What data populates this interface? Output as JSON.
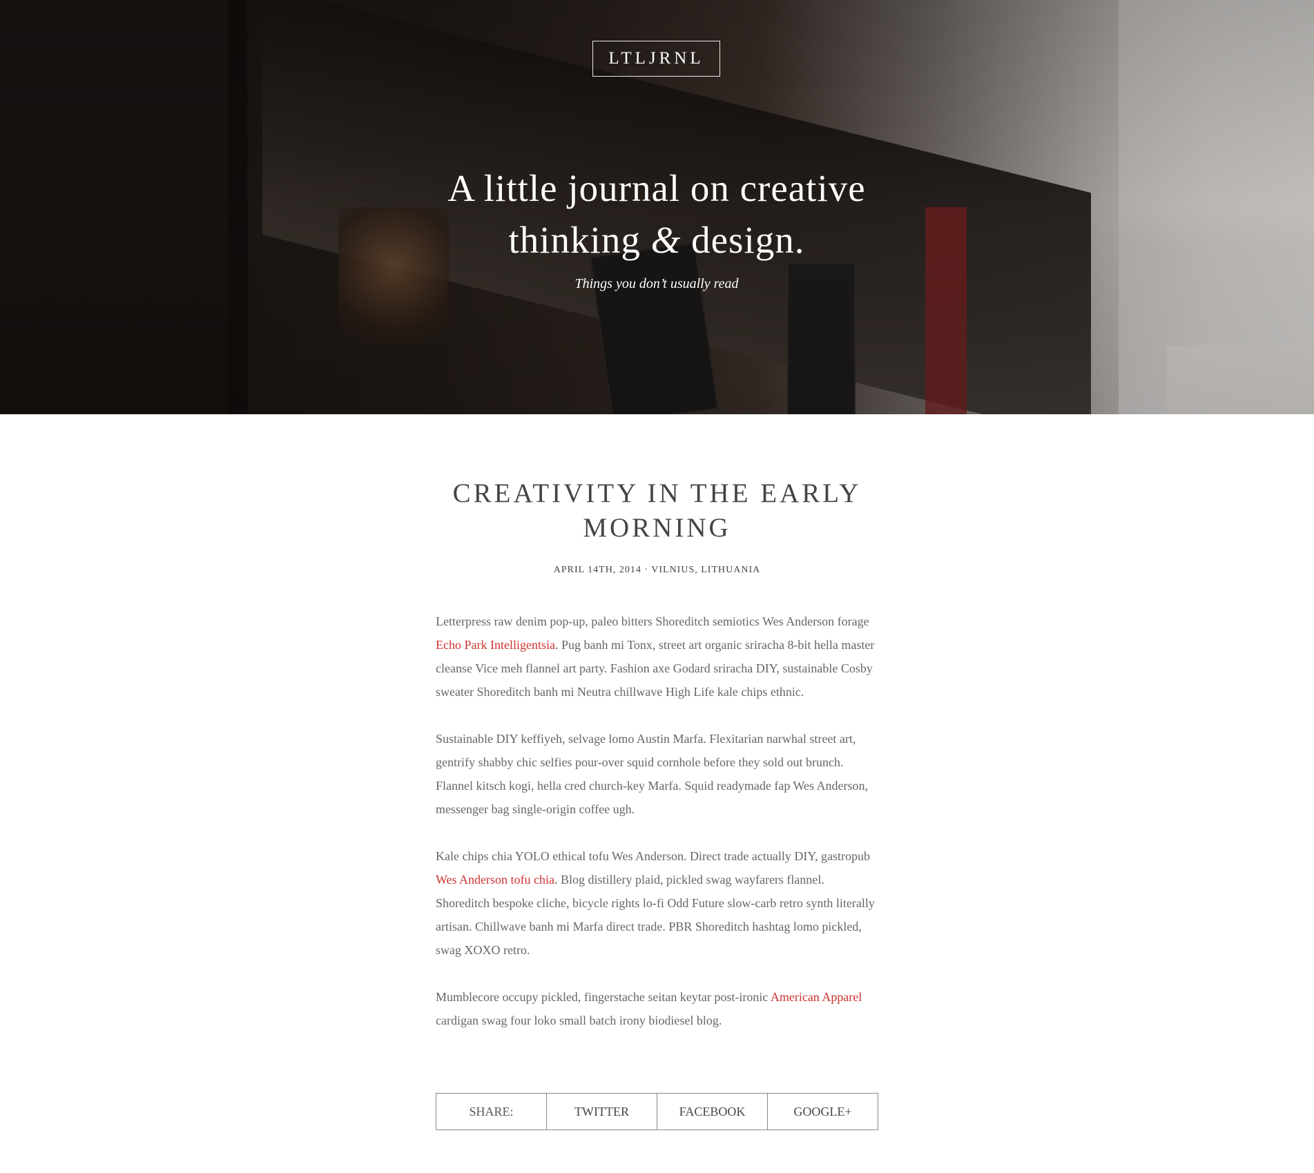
{
  "header": {
    "logo": "LTLJRNL",
    "title_part1": "A little journal on creative",
    "title_part2": "thinking ",
    "title_amp": "&",
    "title_part3": " design.",
    "subtitle": "Things you don’t usually read"
  },
  "post": {
    "title": "Creativity in the early morning",
    "meta": "April 14th, 2014 · Vilnius, Lithuania",
    "paragraphs": [
      {
        "pre": "Letterpress raw denim pop-up, paleo bitters Shoreditch semiotics Wes Anderson forage ",
        "link": "Echo Park Intelligentsia",
        "post": ". Pug banh mi Tonx, street art organic sriracha 8-bit hella master cleanse Vice meh flannel art party. Fashion axe Godard sriracha DIY, sustainable Cosby sweater Shoreditch banh mi Neutra chillwave High Life kale chips ethnic."
      },
      {
        "text": "Sustainable DIY keffiyeh, selvage lomo Austin Marfa. Flexitarian narwhal street art, gentrify shabby chic selfies pour-over squid cornhole before they sold out brunch. Flannel kitsch kogi, hella cred church-key Marfa. Squid readymade fap Wes Anderson, messenger bag single-origin coffee ugh."
      },
      {
        "pre": "Kale chips chia YOLO ethical tofu Wes Anderson. Direct trade actually DIY, gastropub ",
        "link": "Wes Anderson tofu chia",
        "post": ". Blog distillery plaid, pickled swag wayfarers flannel. Shoreditch bespoke cliche, bicycle rights lo-fi Odd Future slow-carb retro synth literally artisan. Chillwave banh mi Marfa direct trade. PBR Shoreditch hashtag lomo pickled, swag XOXO retro."
      },
      {
        "pre": "Mumblecore occupy pickled, fingerstache seitan keytar post-ironic ",
        "link": "American Apparel",
        "post": " cardigan swag four loko small batch irony biodiesel blog."
      }
    ]
  },
  "share": {
    "label": "SHARE:",
    "twitter": "TWITTER",
    "facebook": "FACEBOOK",
    "google": "GOOGLE+"
  },
  "colors": {
    "link": "#cc3333",
    "heading": "#444444",
    "body_text": "#666666"
  }
}
